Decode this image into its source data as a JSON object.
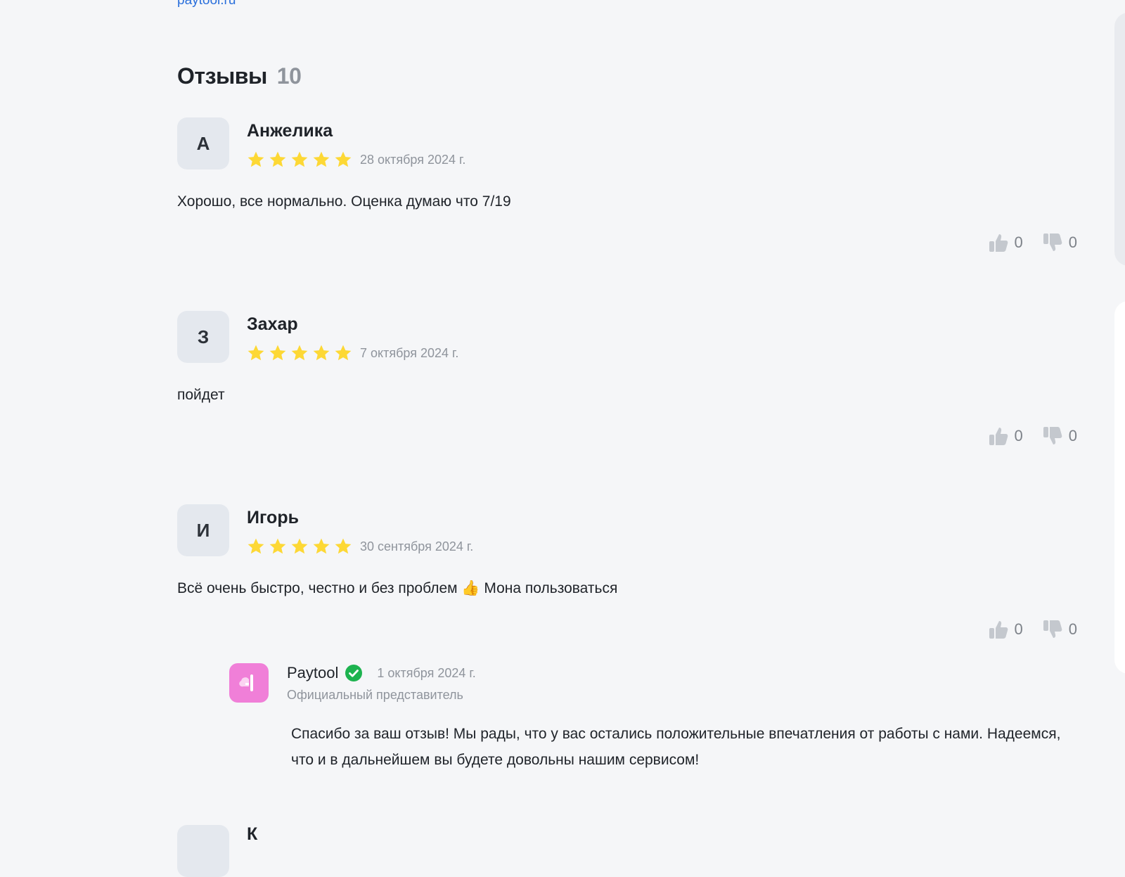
{
  "site_link": "paytool.ru",
  "reviews_section": {
    "title": "Отзывы",
    "count": "10"
  },
  "colors": {
    "star": "#fdd835",
    "link": "#2a6fdb",
    "verified": "#1db34f",
    "brand": "#f07fd8"
  },
  "reviews": [
    {
      "initial": "А",
      "author": "Анжелика",
      "rating": 5,
      "date": "28 октября 2024 г.",
      "text": "Хорошо, все нормально. Оценка думаю что 7/19",
      "likes": "0",
      "dislikes": "0"
    },
    {
      "initial": "З",
      "author": "Захар",
      "rating": 5,
      "date": "7 октября 2024 г.",
      "text": "пойдет",
      "likes": "0",
      "dislikes": "0"
    },
    {
      "initial": "И",
      "author": "Игорь",
      "rating": 5,
      "date": "30 сентября 2024 г.",
      "text": "Всё очень быстро, честно и без проблем 👍 Мона пользоваться",
      "likes": "0",
      "dislikes": "0",
      "reply": {
        "author": "Paytool",
        "date": "1 октября 2024 г.",
        "role": "Официальный представитель",
        "text": "Спасибо за ваш отзыв! Мы рады, что у вас остались положительные впечатления от работы с нами. Надеемся, что и в дальнейшем вы будете довольны нашим сервисом!"
      }
    }
  ],
  "next_review_partial": {
    "initial": "",
    "author": "К"
  }
}
